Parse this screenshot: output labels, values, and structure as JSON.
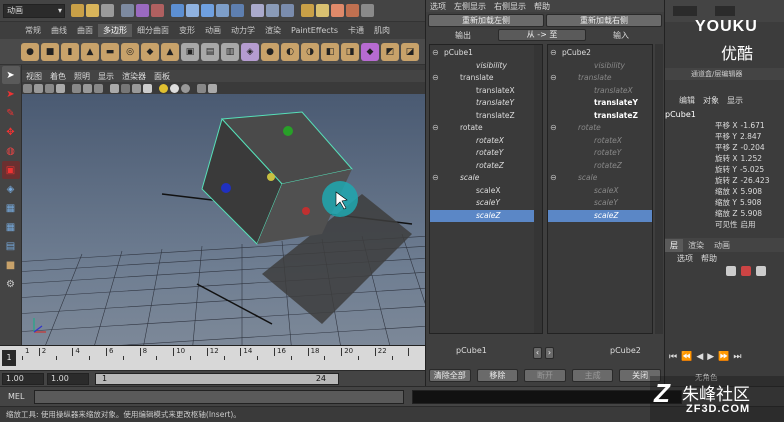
{
  "status_menu": {
    "mode": "动画"
  },
  "shelf_tabs": [
    "常规",
    "曲线",
    "曲面",
    "多边形",
    "细分曲面",
    "变形",
    "动画",
    "动力学",
    "渲染",
    "PaintEffects",
    "卡通",
    "肌肉"
  ],
  "shelf_active_index": 3,
  "viewport": {
    "menu": [
      "视图",
      "着色",
      "照明",
      "显示",
      "渲染器",
      "面板"
    ],
    "frame_numbers": [
      "1",
      "2",
      "4",
      "6",
      "8",
      "10",
      "12",
      "14",
      "16",
      "18",
      "20",
      "22"
    ]
  },
  "range": {
    "start": "1.00",
    "start2": "1.00",
    "current": "1",
    "end": "24"
  },
  "mel": {
    "label": "MEL"
  },
  "help_line": "缩放工具: 使用操纵器来缩放对象。使用编辑模式来更改枢轴(Insert)。",
  "conn_editor": {
    "menu": [
      "选项",
      "左侧显示",
      "右侧显示",
      "帮助"
    ],
    "reload_left": "重新加载左侧",
    "reload_right": "重新加载右侧",
    "output_label": "输出",
    "direction": "从 -> 至",
    "input_label": "输入",
    "left_list": [
      {
        "text": "pCube1",
        "indent": 0,
        "collapse": true,
        "style": "normal"
      },
      {
        "text": "visibility",
        "indent": 2,
        "collapse": false,
        "style": "italic"
      },
      {
        "text": "translate",
        "indent": 1,
        "collapse": true,
        "style": "normal"
      },
      {
        "text": "translateX",
        "indent": 2,
        "collapse": false,
        "style": "normal"
      },
      {
        "text": "translateY",
        "indent": 2,
        "collapse": false,
        "style": "italic"
      },
      {
        "text": "translateZ",
        "indent": 2,
        "collapse": false,
        "style": "normal"
      },
      {
        "text": "rotate",
        "indent": 1,
        "collapse": true,
        "style": "normal"
      },
      {
        "text": "rotateX",
        "indent": 2,
        "collapse": false,
        "style": "italic"
      },
      {
        "text": "rotateY",
        "indent": 2,
        "collapse": false,
        "style": "italic"
      },
      {
        "text": "rotateZ",
        "indent": 2,
        "collapse": false,
        "style": "italic"
      },
      {
        "text": "scale",
        "indent": 1,
        "collapse": true,
        "style": "italic"
      },
      {
        "text": "scaleX",
        "indent": 2,
        "collapse": false,
        "style": "normal"
      },
      {
        "text": "scaleY",
        "indent": 2,
        "collapse": false,
        "style": "italic"
      },
      {
        "text": "scaleZ",
        "indent": 2,
        "collapse": false,
        "style": "selected"
      }
    ],
    "right_list": [
      {
        "text": "pCube2",
        "indent": 0,
        "collapse": true,
        "style": "normal"
      },
      {
        "text": "visibility",
        "indent": 2,
        "collapse": false,
        "style": "dim"
      },
      {
        "text": "translate",
        "indent": 1,
        "collapse": true,
        "style": "dim"
      },
      {
        "text": "translateX",
        "indent": 2,
        "collapse": false,
        "style": "dim"
      },
      {
        "text": "translateY",
        "indent": 2,
        "collapse": false,
        "style": "bold"
      },
      {
        "text": "translateZ",
        "indent": 2,
        "collapse": false,
        "style": "bold"
      },
      {
        "text": "rotate",
        "indent": 1,
        "collapse": true,
        "style": "dim"
      },
      {
        "text": "rotateX",
        "indent": 2,
        "collapse": false,
        "style": "dim"
      },
      {
        "text": "rotateY",
        "indent": 2,
        "collapse": false,
        "style": "dim"
      },
      {
        "text": "rotateZ",
        "indent": 2,
        "collapse": false,
        "style": "dim"
      },
      {
        "text": "scale",
        "indent": 1,
        "collapse": true,
        "style": "dim"
      },
      {
        "text": "scaleX",
        "indent": 2,
        "collapse": false,
        "style": "dim"
      },
      {
        "text": "scaleY",
        "indent": 2,
        "collapse": false,
        "style": "dim"
      },
      {
        "text": "scaleZ",
        "indent": 2,
        "collapse": false,
        "style": "selected"
      }
    ],
    "left_node": "pCube1",
    "right_node": "pCube2",
    "buttons": [
      "清除全部",
      "移除",
      "断开",
      "主成",
      "关闭"
    ]
  },
  "channel_box": {
    "tabs": [
      "通道盒/层编辑器"
    ],
    "menu": [
      "编辑",
      "对象",
      "显示"
    ],
    "object": "pCube1",
    "channels": [
      {
        "name": "平移 X",
        "value": "-1.671"
      },
      {
        "name": "平移 Y",
        "value": "2.847"
      },
      {
        "name": "平移 Z",
        "value": "-0.204"
      },
      {
        "name": "旋转 X",
        "value": "1.252"
      },
      {
        "name": "旋转 Y",
        "value": "-5.025"
      },
      {
        "name": "旋转 Z",
        "value": "-26.423"
      },
      {
        "name": "缩放 X",
        "value": "5.908"
      },
      {
        "name": "缩放 Y",
        "value": "5.908"
      },
      {
        "name": "缩放 Z",
        "value": "5.908"
      },
      {
        "name": "可见性",
        "value": "启用"
      }
    ],
    "layer_tabs": [
      "层",
      "渲染",
      "动画"
    ],
    "layer_menu": [
      "选项",
      "帮助"
    ],
    "no_char": "无角色"
  },
  "watermark": {
    "youku": "YOUKU",
    "youku_cn": "优酷",
    "site": "朱峰社区",
    "url": "ZF3D.COM"
  },
  "colors": {
    "accent": "#62a0d8",
    "selection": "#5b87c6",
    "grid_bg": "#5a6a80"
  }
}
